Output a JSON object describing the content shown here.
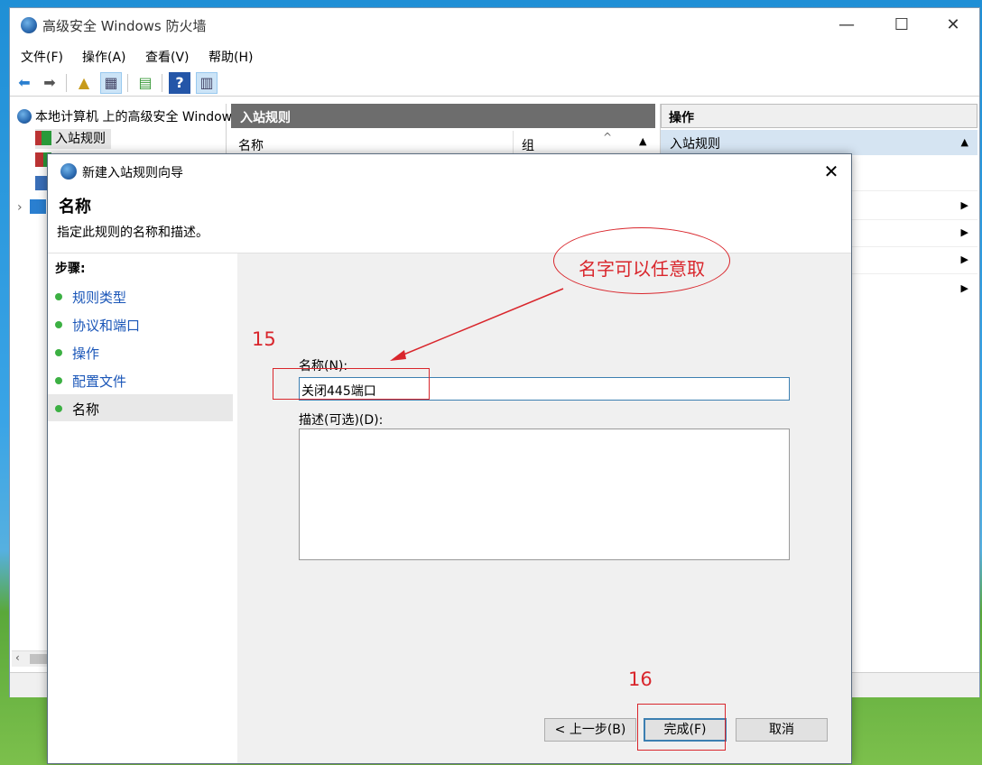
{
  "main_window": {
    "title": "高级安全 Windows 防火墙",
    "controls": {
      "minimize": "—",
      "maximize": "☐",
      "close": "✕"
    },
    "menu": [
      "文件(F)",
      "操作(A)",
      "查看(V)",
      "帮助(H)"
    ],
    "tree": {
      "root": "本地计算机 上的高级安全 Windows",
      "items": [
        "入站规则"
      ]
    },
    "middle_pane": {
      "header": "入站规则",
      "columns": [
        "名称",
        "组"
      ]
    },
    "actions_pane": {
      "header": "操作",
      "section": "入站规则"
    }
  },
  "dialog": {
    "title": "新建入站规则向导",
    "close": "✕",
    "heading": "名称",
    "subtitle": "指定此规则的名称和描述。",
    "steps_title": "步骤:",
    "steps": [
      "规则类型",
      "协议和端口",
      "操作",
      "配置文件",
      "名称"
    ],
    "active_step": "名称",
    "name_label": "名称(N):",
    "name_value": "关闭445端口",
    "desc_label": "描述(可选)(D):",
    "desc_value": "",
    "buttons": {
      "back": "< 上一步(B)",
      "finish": "完成(F)",
      "cancel": "取消"
    }
  },
  "annotations": {
    "step15": "15",
    "step16": "16",
    "callout": "名字可以任意取"
  },
  "colors": {
    "annotation": "#d9262c",
    "accent": "#3c7fb1",
    "link": "#1a56b8"
  }
}
